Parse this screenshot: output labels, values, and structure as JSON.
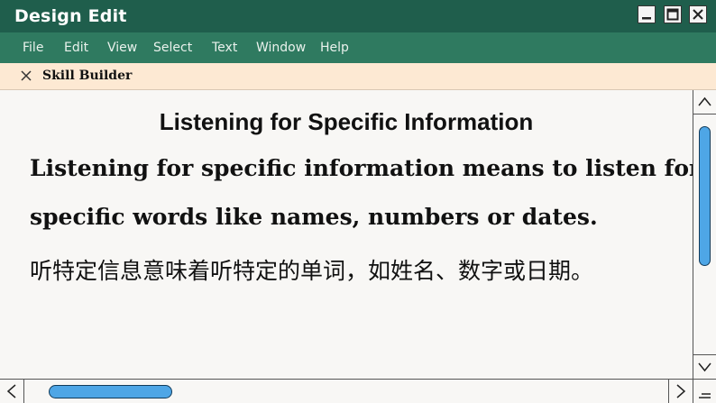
{
  "window": {
    "title": "Design Edit",
    "controls": [
      "minimize-icon",
      "maximize-icon",
      "close-icon"
    ]
  },
  "menu": {
    "items": [
      "File",
      "Edit",
      "View",
      "Select",
      "Text",
      "Window",
      "Help"
    ]
  },
  "tab": {
    "label": "Skill Builder",
    "close_icon": "close-icon"
  },
  "document": {
    "heading": "Listening for Specific Information",
    "line1": "Listening for specific information means to listen for",
    "line2": "specific words like names, numbers or dates.",
    "line3": "听特定信息意味着听特定的单词，如姓名、数字或日期。"
  },
  "colors": {
    "titlebar": "#1f5e4c",
    "menubar": "#2f7a60",
    "tabbar": "#fde9d3",
    "content_bg": "#f8f7f5",
    "scroll_thumb": "#4ea6e6"
  }
}
